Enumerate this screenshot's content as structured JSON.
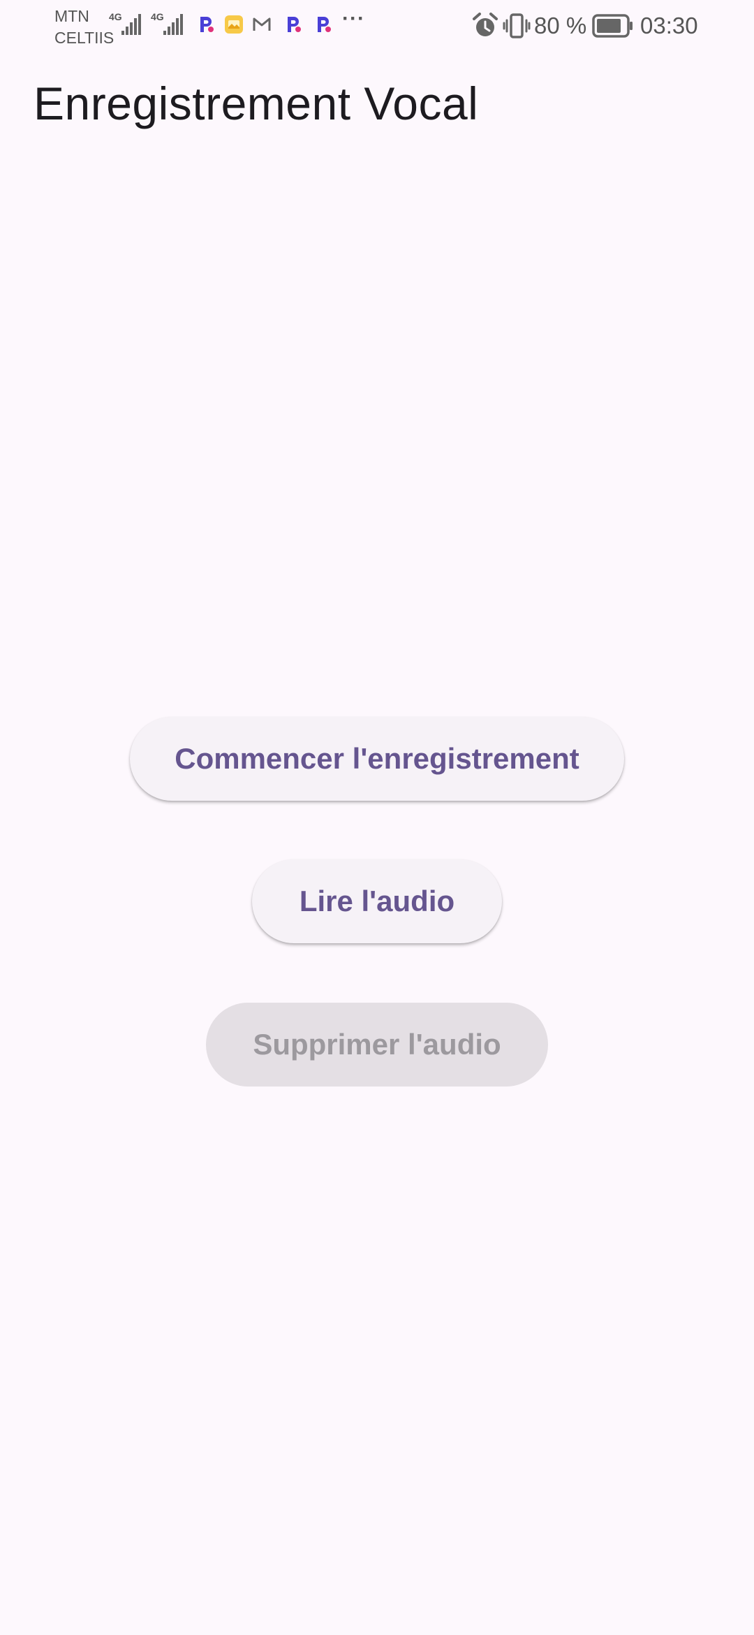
{
  "status_bar": {
    "carrier_line1": "MTN",
    "carrier_line2": "CELTIIS",
    "network_tag_1": "4G",
    "network_tag_2": "4G",
    "more_indicator": "···",
    "battery_percent": "80 %",
    "time": "03:30",
    "icons": [
      "signal-icon",
      "signal-icon",
      "p-app-icon",
      "gallery-icon",
      "gmail-icon",
      "p-app-icon",
      "p-app-icon",
      "alarm-icon",
      "vibrate-icon",
      "battery-icon"
    ]
  },
  "app_bar": {
    "title": "Enregistrement Vocal"
  },
  "actions": {
    "record_label": "Commencer l'enregistrement",
    "play_label": "Lire l'audio",
    "delete_label": "Supprimer l'audio",
    "delete_enabled": false
  },
  "colors": {
    "background": "#fdf8fd",
    "button_bg": "#f6f2f7",
    "button_text": "#65558f",
    "disabled_bg": "#e4dfe4",
    "disabled_text": "#9c999e",
    "title_text": "#1d1b20"
  }
}
